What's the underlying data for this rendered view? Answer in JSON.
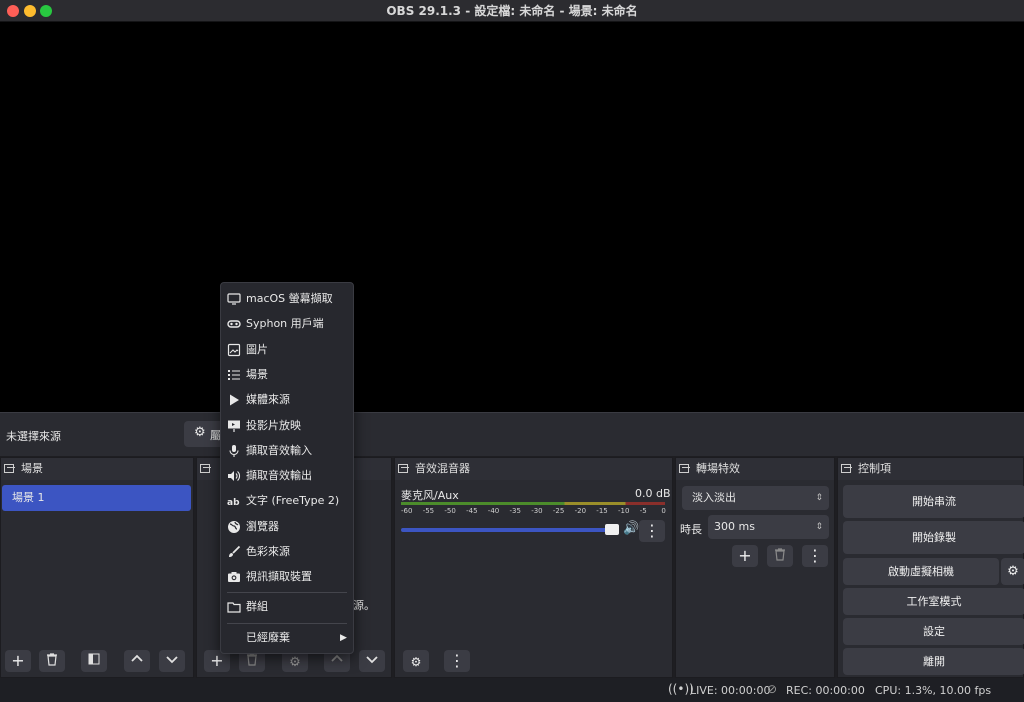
{
  "window": {
    "title": "OBS 29.1.3 - 設定檔: 未命名 - 場景: 未命名"
  },
  "source_bar": {
    "no_source": "未選擇來源",
    "props_button": "屬"
  },
  "scenes": {
    "title": "場景",
    "items": [
      {
        "label": "場景 1",
        "selected": true
      }
    ]
  },
  "sources": {
    "hint_fragment": "源。"
  },
  "mixer": {
    "title": "音效混音器",
    "channel_name": "麥克风/Aux",
    "channel_db": "0.0 dB",
    "ticks": [
      "-60",
      "-55",
      "-50",
      "-45",
      "-40",
      "-35",
      "-30",
      "-25",
      "-20",
      "-15",
      "-10",
      "-5",
      "0"
    ],
    "volume_fraction": 1.0
  },
  "transitions": {
    "title": "轉場特效",
    "selected": "淡入淡出",
    "duration_label": "時長",
    "duration_value": "300 ms"
  },
  "controls": {
    "title": "控制項",
    "start_stream": "開始串流",
    "start_record": "開始錄製",
    "virtual_cam": "啟動虛擬相機",
    "studio_mode": "工作室模式",
    "settings": "設定",
    "exit": "離開"
  },
  "status": {
    "live": "LIVE: 00:00:00",
    "rec": "REC: 00:00:00",
    "cpu": "CPU: 1.3%, 10.00 fps"
  },
  "add_source_menu": {
    "items": [
      {
        "label": "macOS 螢幕擷取",
        "icon": "monitor-icon"
      },
      {
        "label": "Syphon 用戶端",
        "icon": "syphon-icon"
      },
      {
        "label": "圖片",
        "icon": "image-icon"
      },
      {
        "label": "場景",
        "icon": "list-icon"
      },
      {
        "label": "媒體來源",
        "icon": "play-icon"
      },
      {
        "label": "投影片放映",
        "icon": "slideshow-icon"
      },
      {
        "label": "擷取音效輸入",
        "icon": "microphone-icon"
      },
      {
        "label": "擷取音效輸出",
        "icon": "speaker-icon"
      },
      {
        "label": "文字 (FreeType 2)",
        "icon": "text-icon"
      },
      {
        "label": "瀏覽器",
        "icon": "globe-icon"
      },
      {
        "label": "色彩來源",
        "icon": "brush-icon"
      },
      {
        "label": "視訊擷取裝置",
        "icon": "camera-icon"
      }
    ],
    "group": {
      "label": "群組",
      "icon": "folder-icon"
    },
    "deprecated": {
      "label": "已經廢棄"
    }
  },
  "colors": {
    "accent": "#3c55c2",
    "meter_green": "#4c8c2b",
    "traffic_red": "#fe5f57",
    "traffic_yellow": "#febc2e",
    "traffic_green": "#28c840"
  }
}
